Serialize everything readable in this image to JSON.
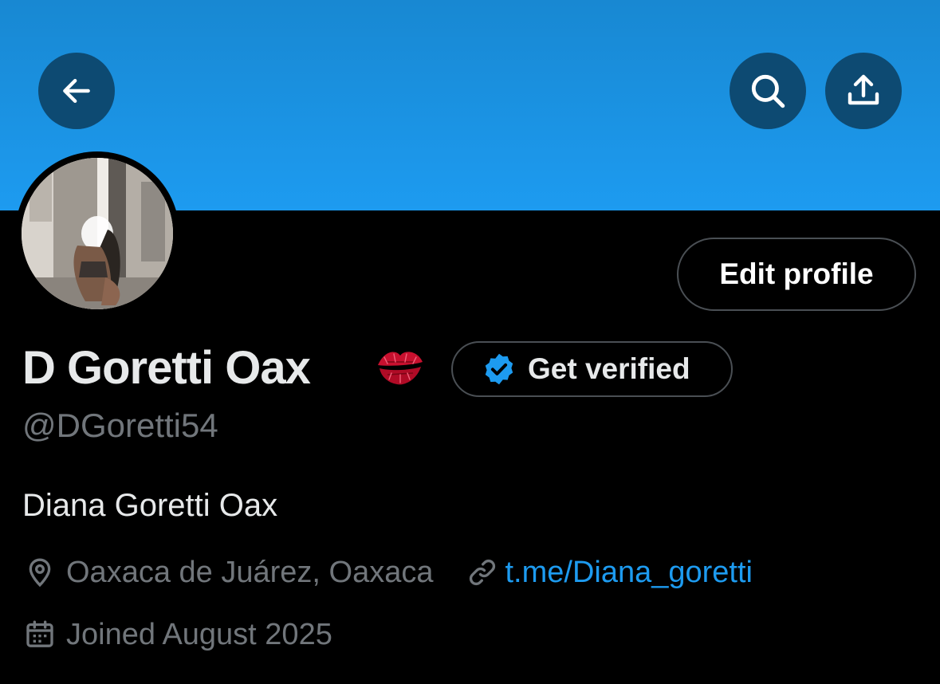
{
  "header": {
    "back_icon": "arrow-left-icon",
    "search_icon": "search-icon",
    "share_icon": "share-upload-icon",
    "banner_color": "#1d9bf0"
  },
  "profile": {
    "display_name": "D Goretti Oax",
    "name_emoji": "💋",
    "handle": "@DGoretti54",
    "bio": "Diana Goretti Oax",
    "location": "Oaxaca de Juárez, Oaxaca",
    "website": "t.me/Diana_goretti",
    "joined": "Joined August 2025"
  },
  "actions": {
    "edit_profile_label": "Edit profile",
    "get_verified_label": "Get verified"
  },
  "colors": {
    "accent": "#1d9bf0",
    "text_primary": "#e7e9ea",
    "text_secondary": "#71767b",
    "background": "#000000"
  }
}
